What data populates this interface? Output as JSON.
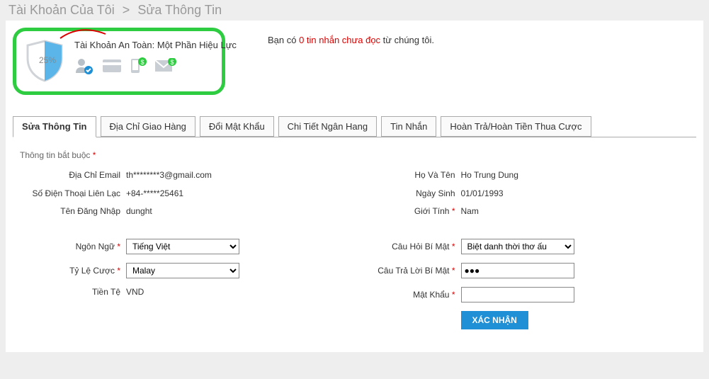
{
  "breadcrumb": {
    "root": "Tài Khoản Của Tôi",
    "sep": ">",
    "current": "Sửa Thông Tin"
  },
  "security": {
    "percent": "25%",
    "title_pre": "Tài Khoản An Toàn: ",
    "title_status": "Một Phần Hiệu Lực"
  },
  "message": {
    "pre": "Bạn có ",
    "count": "0 tin nhắn chưa đọc",
    "post": " từ chúng tôi."
  },
  "tabs": [
    "Sửa Thông Tin",
    "Địa Chỉ Giao Hàng",
    "Đổi Mật Khẩu",
    "Chi Tiết Ngân Hang",
    "Tin Nhắn",
    "Hoàn Trả/Hoàn Tiền Thua Cược"
  ],
  "required_note": "Thông tin bắt buộc",
  "left_fields": {
    "email_label": "Địa Chỉ Email",
    "email_value": "th********3@gmail.com",
    "phone_label": "Số Điện Thoại Liên Lạc",
    "phone_value": "+84-*****25461",
    "username_label": "Tên Đăng Nhập",
    "username_value": "dunght"
  },
  "right_fields": {
    "fullname_label": "Họ Và Tên",
    "fullname_value": "Ho Trung Dung",
    "dob_label": "Ngày Sinh",
    "dob_value": "01/01/1993",
    "gender_label": "Giới Tính",
    "gender_value": "Nam"
  },
  "form": {
    "language_label": "Ngôn Ngữ",
    "language_value": "Tiếng Việt",
    "odds_label": "Tỷ Lệ Cược",
    "odds_value": "Malay",
    "currency_label": "Tiền Tệ",
    "currency_value": "VND",
    "secq_label": "Câu Hỏi Bí Mật",
    "secq_value": "Biệt danh thời thơ ấu",
    "seca_label": "Câu Trả Lời Bí Mật",
    "seca_value": "●●●",
    "password_label": "Mật Khẩu",
    "password_value": "",
    "submit": "XÁC NHẬN"
  }
}
